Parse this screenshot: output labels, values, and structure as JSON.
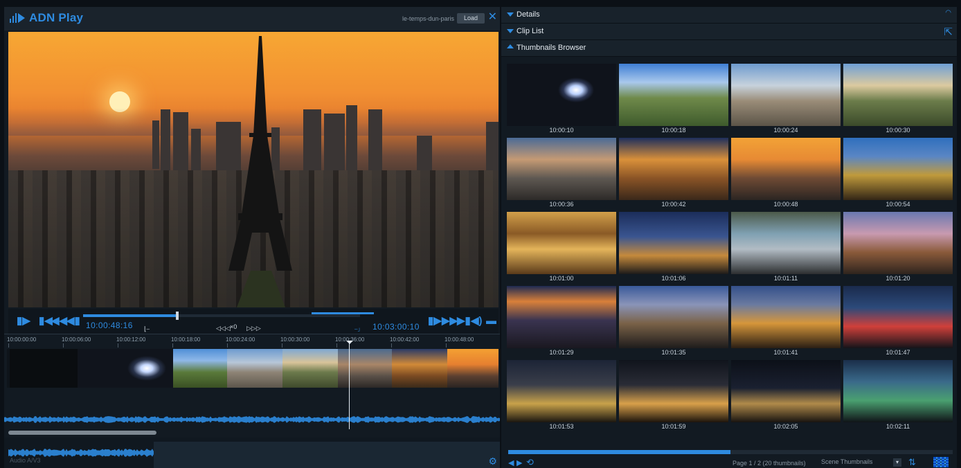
{
  "app": {
    "name": "ADN Play"
  },
  "topbar": {
    "file_name": "le-temps-dun-paris",
    "load_label": "Load",
    "close_glyph": "✕"
  },
  "player": {
    "in_timecode": "10:00:48:16",
    "out_timecode": "10:03:00:10",
    "speed_label": "×0",
    "progress_fraction": 0.34,
    "controls": {
      "prev_mark": "▮▶",
      "go_start": "▮◀",
      "rewind": "◀◀",
      "step_back": "◀▮",
      "play": "▮▶",
      "fast_forward": "▶▶",
      "go_end": "▶▮",
      "volume": "◀)",
      "fullscreen": "▬"
    },
    "jog_back": "◁◁◁",
    "jog_fwd": "▷▷▷"
  },
  "timeline": {
    "ticks": [
      "10:00:00:00",
      "10:00:06:00",
      "10:00:12:00",
      "10:00:18:00",
      "10:00:24:00",
      "10:00:30:00",
      "10:00:36:00",
      "10:00:42:00",
      "10:00:48:00"
    ],
    "audio_label": "Audio A/V3"
  },
  "panels": {
    "details_label": "Details",
    "cliplist_label": "Clip List",
    "thumbnails_label": "Thumbnails Browser"
  },
  "thumbnails": [
    {
      "time": "10:00:10",
      "style": "flare"
    },
    {
      "time": "10:00:18",
      "style": "day-tower"
    },
    {
      "time": "10:00:24",
      "style": "day-city"
    },
    {
      "time": "10:00:30",
      "style": "day-trocadero"
    },
    {
      "time": "10:00:36",
      "style": "dusk-skyline"
    },
    {
      "time": "10:00:42",
      "style": "tower-base"
    },
    {
      "time": "10:00:48",
      "style": "sunset-tower"
    },
    {
      "time": "10:00:54",
      "style": "night-garden"
    },
    {
      "time": "10:01:00",
      "style": "gallery"
    },
    {
      "time": "10:01:06",
      "style": "blue-city"
    },
    {
      "time": "10:01:11",
      "style": "fountain"
    },
    {
      "time": "10:01:20",
      "style": "pink-tower"
    },
    {
      "time": "10:01:29",
      "style": "night-aerial"
    },
    {
      "time": "10:01:35",
      "style": "night-streets"
    },
    {
      "time": "10:01:41",
      "style": "night-avenue"
    },
    {
      "time": "10:01:47",
      "style": "night-towers"
    },
    {
      "time": "10:01:53",
      "style": "liberty"
    },
    {
      "time": "10:01:59",
      "style": "notre-dame"
    },
    {
      "time": "10:02:05",
      "style": "concorde"
    },
    {
      "time": "10:02:11",
      "style": "defense"
    }
  ],
  "footer": {
    "page_info": "Page 1 / 2 (20 thumbnails)",
    "mode_value": "Scene Thumbnails",
    "page_scroll_fraction": 0.5
  },
  "colors": {
    "accent": "#2e8be0",
    "panel": "#121a22",
    "header": "#18222b"
  }
}
